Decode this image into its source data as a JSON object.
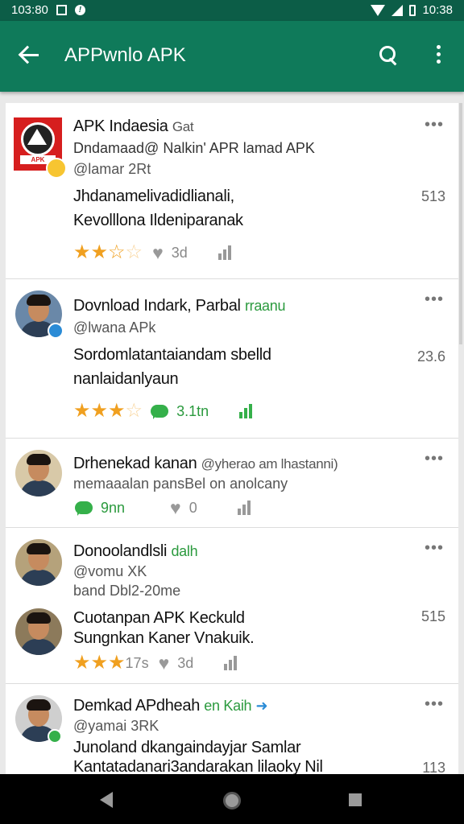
{
  "status": {
    "time_left": "103:80",
    "time_right": "10:38"
  },
  "app": {
    "title": "APPwnlo APK"
  },
  "posts": [
    {
      "name": "APK Indaesia",
      "name_extra": "Gat",
      "handle_line": "Dndamaad@ Nalkin' APR lamad APK",
      "handle": "@lamar 2Rt",
      "body1": "Jhdanamelivadidlianali,",
      "body2": "Kevolllona Ildeniparanak",
      "count": "513",
      "metric": "3d",
      "stars": 2.5
    },
    {
      "name": "Dovnload Indark, Parbal",
      "name_extra": "rraanu",
      "handle": "@lwana APk",
      "body1": "Sordomlatantaiandam sbelld",
      "body2": "nanlaidanlyaun",
      "count": "23.6",
      "metric": "3.1tn",
      "stars": 3.5
    },
    {
      "name": "Drhenekad kanan",
      "name_extra": "@yherao am lhastanni)",
      "handle": "memaaalan pansBel on anolcany",
      "metric": "9nn",
      "metric2": "0"
    },
    {
      "name": "Donoolandlsli",
      "name_extra": "dalh",
      "handle": "@vomu XK",
      "sub": "band Dbl2-20me",
      "body1": "Cuotanpan APK Keckuld",
      "body2": "Sungnkan Kaner Vnakuik.",
      "count": "515",
      "metric": "3d",
      "rating_text": "17s",
      "stars": 2.5
    },
    {
      "name": "Demkad APdheah",
      "name_extra": "en Kaih",
      "handle": "@yamai 3RK",
      "body1": "Junoland dkangaindayjar Samlar",
      "body2": "Kantatadanari3andarakan lilaoky Nil",
      "count": "113"
    }
  ],
  "icons": {
    "back": "arrow-back-icon",
    "search": "search-icon",
    "overflow": "more-vert-icon"
  },
  "colors": {
    "appbar": "#0f7a5a",
    "statusbar": "#0c5d47",
    "star": "#f0a020",
    "accent_green": "#35b04a"
  }
}
